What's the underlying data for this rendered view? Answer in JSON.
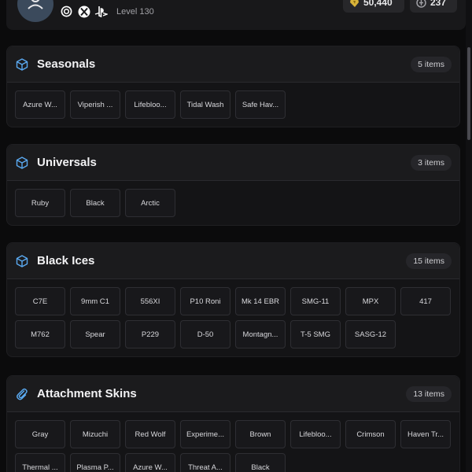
{
  "header": {
    "level": "Level 130",
    "platforms": [
      "ubisoft-icon",
      "xbox-icon",
      "playstation-icon"
    ],
    "credits": "50,440",
    "renown": "237"
  },
  "sections": [
    {
      "title": "Seasonals",
      "icon": "cube-icon",
      "count": "5 items",
      "items": [
        "Azure W...",
        "Viperish ...",
        "Lifebloo...",
        "Tidal Wash",
        "Safe Hav..."
      ]
    },
    {
      "title": "Universals",
      "icon": "cube-icon",
      "count": "3 items",
      "items": [
        "Ruby",
        "Black",
        "Arctic"
      ]
    },
    {
      "title": "Black Ices",
      "icon": "cube-icon",
      "count": "15 items",
      "items": [
        "C7E",
        "9mm C1",
        "556XI",
        "P10 Roni",
        "Mk 14 EBR",
        "SMG-11",
        "MPX",
        "417",
        "M762",
        "Spear",
        "P229",
        "D-50",
        "Montagn...",
        "T-5 SMG",
        "SASG-12"
      ]
    },
    {
      "title": "Attachment Skins",
      "icon": "paperclip-icon",
      "count": "13 items",
      "items": [
        "Gray",
        "Mizuchi",
        "Red Wolf",
        "Experime...",
        "Brown",
        "Lifebloo...",
        "Crimson",
        "Haven Tr...",
        "Thermal ...",
        "Plasma P...",
        "Azure W...",
        "Threat A...",
        "Black"
      ]
    }
  ],
  "colors": {
    "accent": "#5aa9f0",
    "credits": "#d9b43a"
  }
}
